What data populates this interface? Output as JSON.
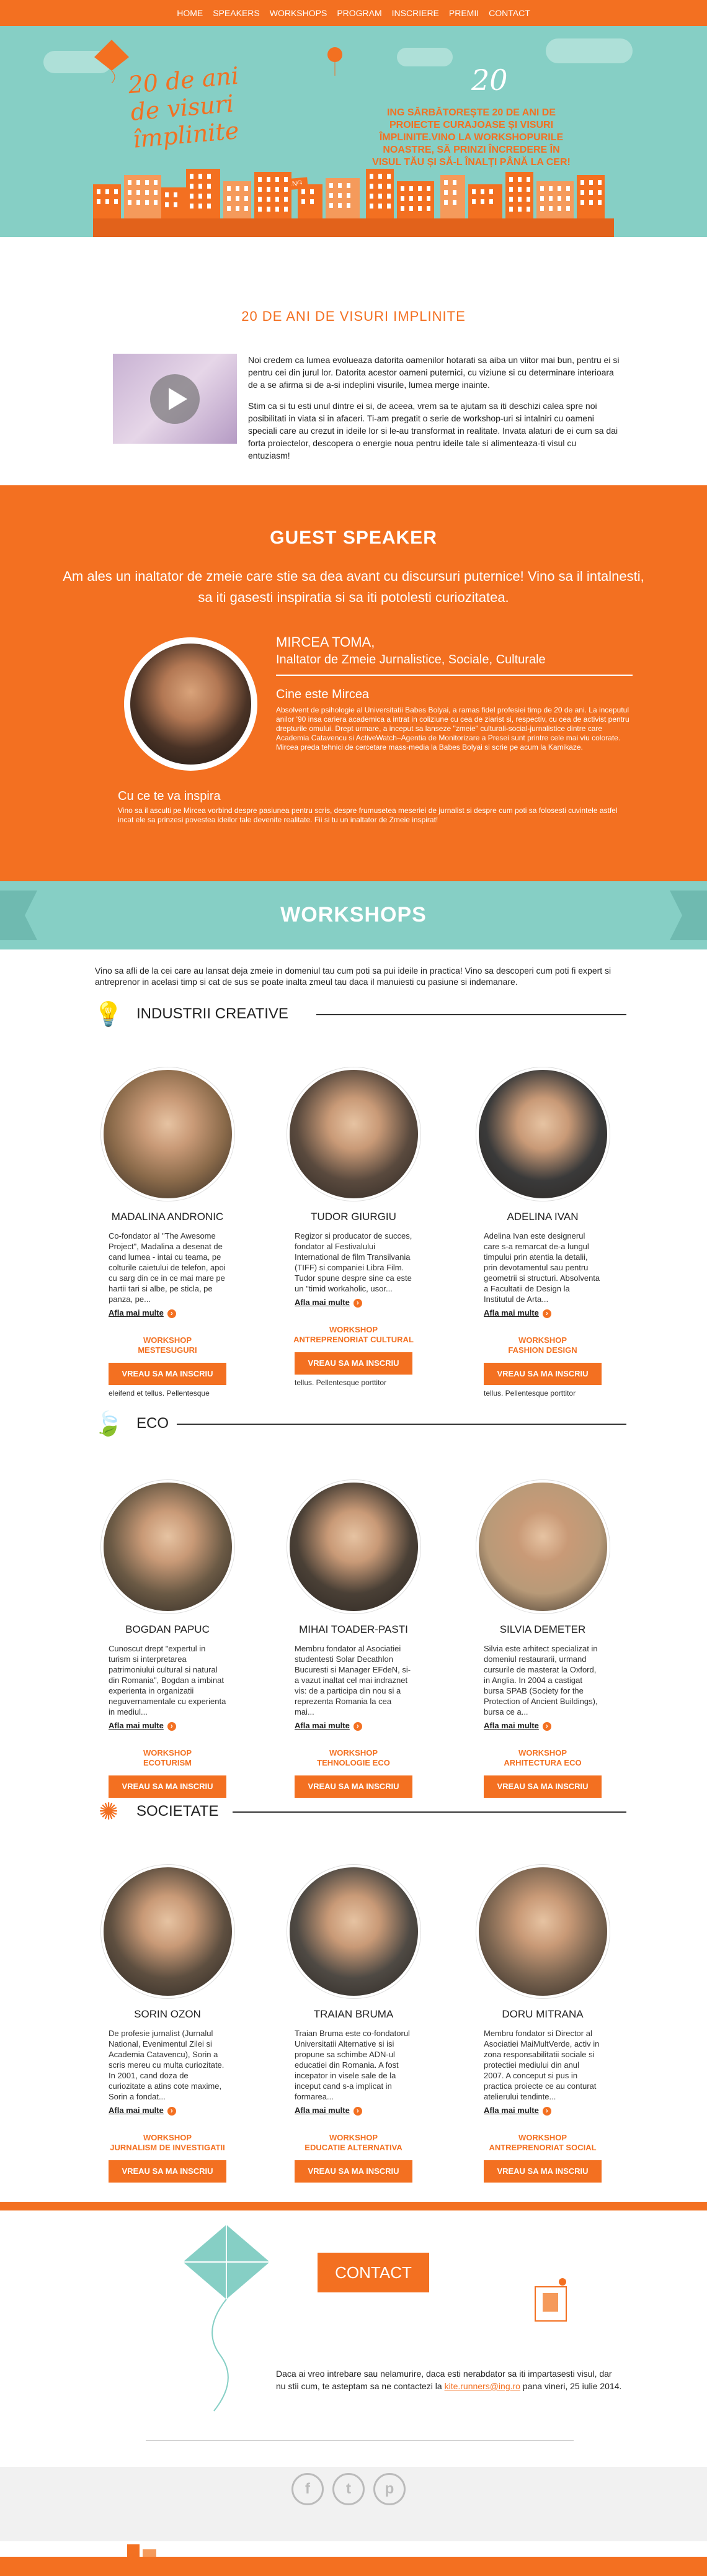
{
  "nav": [
    "HOME",
    "SPEAKERS",
    "WORKSHOPS",
    "PROGRAM",
    "INSCRIERE",
    "PREMII",
    "CONTACT"
  ],
  "hero": {
    "title_lines": [
      "20 de ani",
      "de visuri",
      "împlinite"
    ],
    "badge": "ING",
    "big_number": "20",
    "text": "ING SĂRBĂTOREȘTE 20 DE ANI DE PROIECTE CURAJOASE ȘI VISURI ÎMPLINITE.VINO LA WORKSHOPURILE NOASTRE, SĂ PRINZI ÎNCREDERE ÎN VISUL TĂU ȘI SĂ-L ÎNALȚI PÂNĂ LA CER!"
  },
  "intro": {
    "title": "20 DE ANI DE VISURI IMPLINITE",
    "p1": "Noi credem ca lumea evolueaza datorita oamenilor hotarati sa aiba un viitor mai bun, pentru ei si pentru cei din jurul lor. Datorita acestor oameni puternici, cu viziune si cu determinare interioara de a se afirma si de a-si indeplini visurile, lumea merge inainte.",
    "p2": "Stim ca si tu esti unul dintre ei si, de aceea, vrem sa te ajutam sa iti deschizi calea spre noi posibilitati in viata si in afaceri. Ti-am pregatit o serie de workshop-uri si intalniri cu oameni speciali care au crezut in ideile lor si le-au transformat in realitate. Invata alaturi de ei cum sa dai forta proiectelor, descopera o energie noua pentru ideile tale si alimenteaza-ti visul cu entuziasm!"
  },
  "guest": {
    "title": "GUEST SPEAKER",
    "subtitle": "Am ales un inaltator de zmeie care stie sa dea avant cu discursuri puternice! Vino sa il intalnesti, sa iti gasesti inspiratia si sa iti potolesti curiozitatea.",
    "name": "MIRCEA TOMA,",
    "role": "Inaltator de Zmeie Jurnalistice, Sociale, Culturale",
    "h1": "Cine este Mircea",
    "p1": "Absolvent de psihologie al Universitatii Babes Bolyai, a ramas fidel profesiei timp de 20 de ani. La inceputul anilor '90 insa cariera academica a intrat in coliziune cu cea de ziarist si, respectiv, cu cea de activist pentru drepturile omului. Drept urmare, a inceput sa lanseze \"zmeie\" culturali-social-jurnalistice dintre care Academia Catavencu si ActiveWatch–Agentia de Monitorizare a Presei sunt printre cele mai viu colorate. Mircea preda tehnici de cercetare mass-media la Babes Bolyai si scrie pe acum la Kamikaze.",
    "h2": "Cu ce te va inspira",
    "p2": "Vino sa il asculti pe Mircea vorbind despre pasiunea pentru scris, despre frumusetea meseriei de jurnalist si despre cum poti sa folosesti cuvintele astfel incat ele sa prinzesi povestea ideilor tale devenite realitate. Fii si tu un inaltator de Zmeie inspirat!"
  },
  "workshops": {
    "title": "WORKSHOPS",
    "intro": "Vino sa afli de la cei care au lansat deja zmeie in domeniul tau cum poti sa pui ideile in practica! Vino sa descoperi cum poti fi expert si antreprenor in acelasi timp si cat de sus se poate inalta zmeul tau daca il manuiesti cu pasiune si indemanare.",
    "more_label": "Afla mai multe",
    "button_label": "VREAU SA MA INSCRIU",
    "categories": [
      {
        "name": "INDUSTRII CREATIVE",
        "icon": "lightbulb-icon",
        "people": [
          {
            "name": "MADALINA ANDRONIC",
            "desc": "Co-fondator al \"The Awesome Project\", Madalina a desenat de cand lumea - intai cu teama, pe colturile caietului de telefon, apoi cu sarg din ce in ce mai mare pe hartii tari si albe, pe sticla, pe panza, pe...",
            "ws": "WORKSHOP\nMESTESUGURI",
            "extra": "eleifend et tellus. Pellentesque",
            "color": "#8a6a4a"
          },
          {
            "name": "TUDOR GIURGIU",
            "desc": "Regizor si producator de succes, fondator al Festivalului International de film Transilvania (TIFF) si companiei Libra Film. Tudor spune despre sine ca este un \"timid workaholic, usor...",
            "ws": "WORKSHOP\nANTREPRENORIAT CULTURAL",
            "extra": "tellus. Pellentesque porttitor",
            "color": "#5a4a3e"
          },
          {
            "name": "ADELINA IVAN",
            "desc": "Adelina Ivan este designerul care s-a remarcat de-a lungul timpului prin atentia la detalii, prin devotamentul sau pentru geometrii si structuri. Absolventa a Facultatii de Design la Institutul de Arta...",
            "ws": "WORKSHOP\nFASHION DESIGN",
            "extra": "tellus. Pellentesque porttitor",
            "color": "#3a3a3a"
          }
        ]
      },
      {
        "name": "ECO",
        "icon": "leaf-icon",
        "people": [
          {
            "name": "BOGDAN PAPUC",
            "desc": "Cunoscut drept \"expertul in turism si interpretarea patrimoniului cultural si natural din Romania\", Bogdan a imbinat experienta in organizatii neguvernamentale cu experienta in mediul...",
            "ws": "WORKSHOP\nECOTURISM",
            "extra": "",
            "color": "#6b5a45"
          },
          {
            "name": "MIHAI TOADER-PASTI",
            "desc": "Membru fondator al Asociatiei studentesti Solar Decathlon Bucuresti si Manager EFdeN, si-a vazut inaltat cel mai indraznet vis: de a participa din nou si a reprezenta Romania la cea mai...",
            "ws": "WORKSHOP\nTEHNOLOGIE ECO",
            "extra": "",
            "color": "#4a4036"
          },
          {
            "name": "SILVIA DEMETER",
            "desc": "Silvia este arhitect specializat in domeniul restaurarii, urmand cursurile de masterat la Oxford, in Anglia. In 2004 a castigat bursa SPAB (Society for the Protection of Ancient Buildings), bursa ce a...",
            "ws": "WORKSHOP\nARHITECTURA ECO",
            "extra": "",
            "color": "#b89a78"
          }
        ]
      },
      {
        "name": "SOCIETATE",
        "icon": "people-icon",
        "people": [
          {
            "name": "SORIN OZON",
            "desc": "De profesie jurnalist (Jurnalul National, Evenimentul Zilei si Academia Catavencu), Sorin a scris mereu cu multa curiozitate. In 2001, cand doza de curiozitate a atins cote maxime, Sorin a fondat...",
            "ws": "WORKSHOP\nJURNALISM DE INVESTIGATII",
            "extra": "",
            "color": "#5e4f40"
          },
          {
            "name": "TRAIAN BRUMA",
            "desc": "Traian Bruma este co-fondatorul Universitatii Alternative si isi propune sa schimbe ADN-ul educatiei din Romania. A fost incepator in visele sale de la inceput cand s-a implicat in formarea...",
            "ws": "WORKSHOP\nEDUCATIE ALTERNATIVA",
            "extra": "",
            "color": "#4f4a44"
          },
          {
            "name": "DORU MITRANA",
            "desc": "Membru fondator si Director al Asociatiei MaiMultVerde, activ in zona responsabilitatii sociale si protectiei mediului din anul 2007. A conceput si pus in practica proiecte ce au conturat atelierului tendinte...",
            "ws": "WORKSHOP\nANTREPRENORIAT SOCIAL",
            "extra": "",
            "color": "#7a6450"
          }
        ]
      }
    ]
  },
  "contact": {
    "button": "CONTACT",
    "text_before": "Daca ai vreo intrebare sau nelamurire, daca esti nerabdator sa iti impartasesti visul, dar nu stii cum, te asteptam sa ne contactezi la ",
    "email": "kite.runners@ing.ro",
    "text_after": " pana vineri, 25 iulie 2014."
  },
  "social": [
    "facebook-icon",
    "twitter-icon",
    "pinterest-icon"
  ],
  "colors": {
    "accent": "#f37021",
    "teal": "#86cfc5"
  }
}
